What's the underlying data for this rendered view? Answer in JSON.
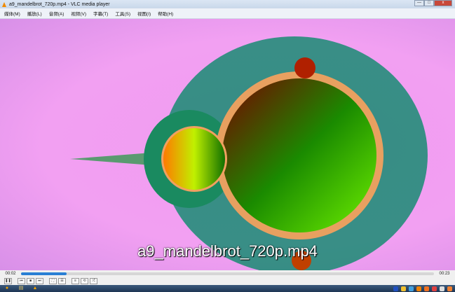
{
  "window": {
    "title": "a9_mandelbrot_720p.mp4 - VLC media player",
    "minimize": "—",
    "maximize": "□",
    "close": "x"
  },
  "menu": [
    "媒体(M)",
    "播放(L)",
    "音频(A)",
    "视频(V)",
    "字幕(T)",
    "工具(S)",
    "视图(I)",
    "帮助(H)"
  ],
  "video": {
    "subtitle": "a9_mandelbrot_720p.mp4"
  },
  "playback": {
    "elapsed": "00:02",
    "total": "00:23",
    "progress": 0.11
  },
  "controls": {
    "play_pause": "❚❚",
    "prev": "⏮",
    "stop": "■",
    "next": "⏭",
    "fullscreen": "⛶",
    "extended": "☰",
    "playlist": "≡",
    "loop": "⟲",
    "random": "⤮"
  },
  "colors": {
    "accent": "#2a7fd4",
    "background": "#f2a0f2"
  }
}
